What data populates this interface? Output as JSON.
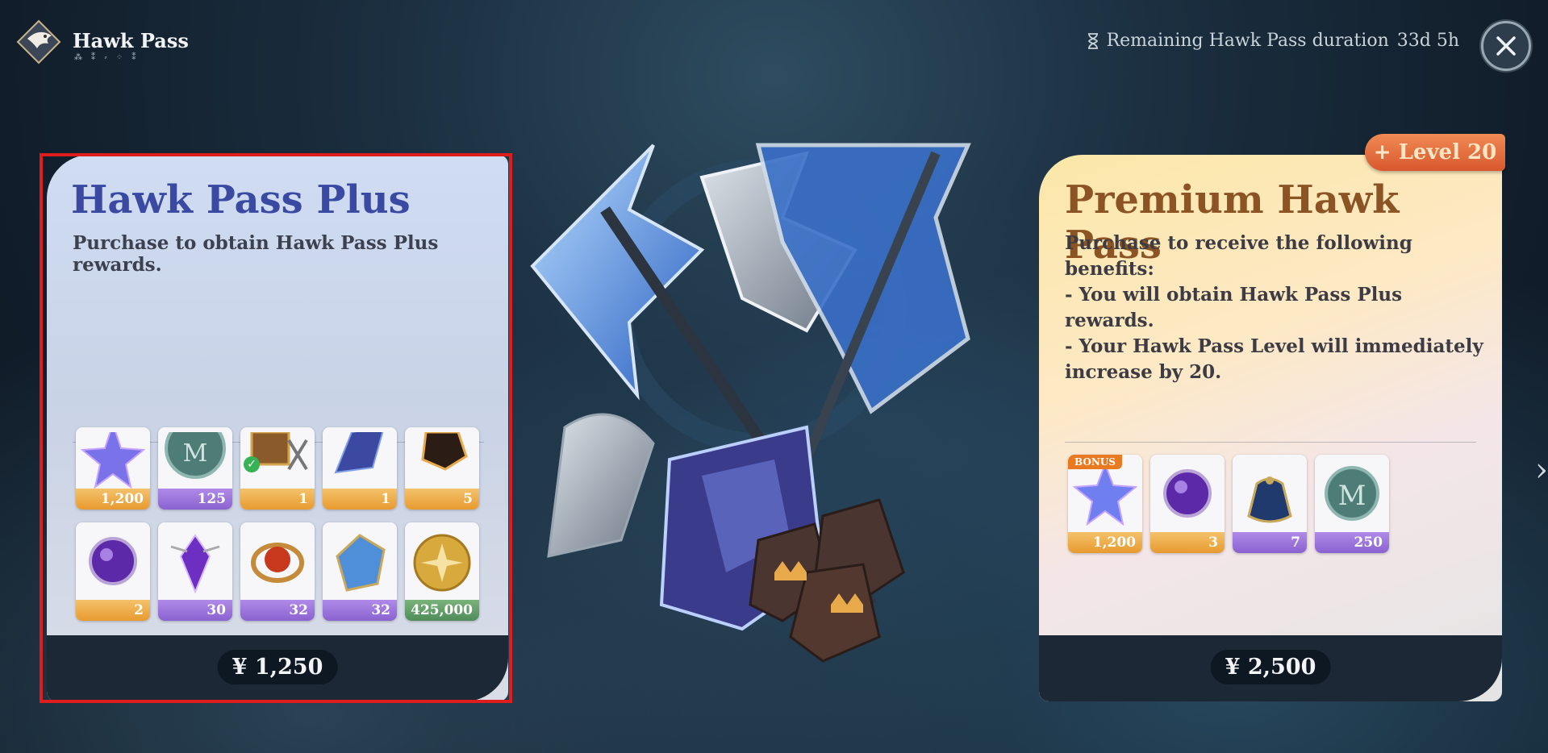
{
  "header": {
    "title": "Hawk Pass",
    "subtitle": "⁂ ⁑ ⸗ ⁘ ⁑",
    "timer_label": "Remaining Hawk Pass duration",
    "timer_value": "33d 5h"
  },
  "plus_card": {
    "title": "Hawk Pass Plus",
    "description": "Purchase to obtain Hawk Pass Plus rewards.",
    "price": "¥ 1,250",
    "items_row1": [
      {
        "icon": "star-crystal-icon",
        "qty": "1,200",
        "rarity": "gold"
      },
      {
        "icon": "m-coin-icon",
        "qty": "125",
        "rarity": "purple"
      },
      {
        "icon": "treasure-chest-icon",
        "qty": "1",
        "rarity": "gold"
      },
      {
        "icon": "blue-shard-icon",
        "qty": "1",
        "rarity": "gold"
      },
      {
        "icon": "dark-ore-icon",
        "qty": "5",
        "rarity": "gold"
      }
    ],
    "items_row2": [
      {
        "icon": "purple-orb-icon",
        "qty": "2",
        "rarity": "gold"
      },
      {
        "icon": "purple-gem-icon",
        "qty": "30",
        "rarity": "purple"
      },
      {
        "icon": "fire-ring-icon",
        "qty": "32",
        "rarity": "purple"
      },
      {
        "icon": "blue-cube-icon",
        "qty": "32",
        "rarity": "purple"
      },
      {
        "icon": "gold-coin-icon",
        "qty": "425,000",
        "rarity": "green"
      }
    ]
  },
  "premium_card": {
    "badge": "+ Level 20",
    "title": "Premium Hawk Pass",
    "desc_line1": "Purchase to receive the following benefits:",
    "desc_line2": "- You will obtain Hawk Pass Plus rewards.",
    "desc_line3": "- Your Hawk Pass Level will immediately increase by 20.",
    "price": "¥ 2,500",
    "bonus_label": "BONUS",
    "items": [
      {
        "icon": "star-crystal-icon",
        "qty": "1,200",
        "rarity": "gold"
      },
      {
        "icon": "purple-orb-icon",
        "qty": "3",
        "rarity": "gold"
      },
      {
        "icon": "pouch-icon",
        "qty": "7",
        "rarity": "purple"
      },
      {
        "icon": "m-coin-icon",
        "qty": "250",
        "rarity": "purple"
      }
    ]
  },
  "colors": {
    "plus_title": "#3a4aa2",
    "premium_title": "#8c5424",
    "selection": "#e01d1d",
    "badge": "#e0642f"
  }
}
